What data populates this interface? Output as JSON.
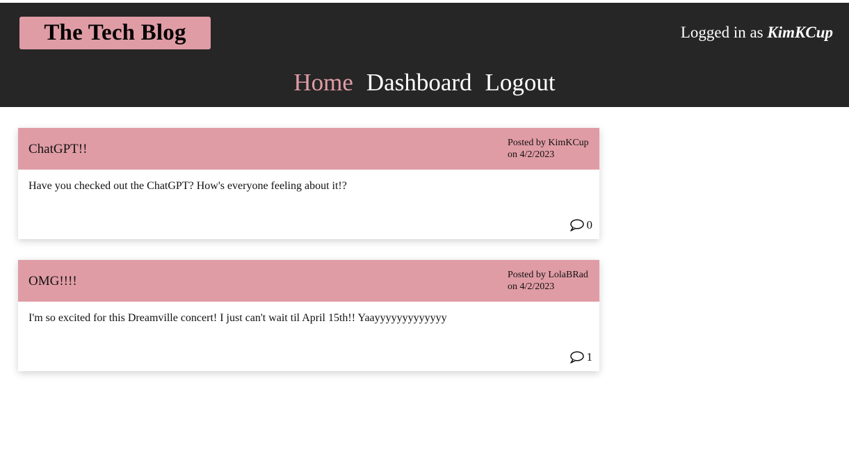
{
  "header": {
    "title": "The Tech Blog",
    "logged_in_prefix": "Logged in as ",
    "username": "KimKCup",
    "accent_color": "#e09ca5",
    "background_color": "#262626"
  },
  "nav": {
    "home": "Home",
    "dashboard": "Dashboard",
    "logout": "Logout",
    "active": "Home"
  },
  "posts": [
    {
      "title": "ChatGPT!!",
      "posted_by": "Posted by KimKCup",
      "date": "on 4/2/2023",
      "content": "Have you checked out the ChatGPT? How's everyone feeling about it!?",
      "comment_count": "0",
      "comment_icon": "speech-bubble-icon"
    },
    {
      "title": "OMG!!!!",
      "posted_by": "Posted by LolaBRad",
      "date": "on 4/2/2023",
      "content": "I'm so excited for this Dreamville concert! I just can't wait til April 15th!! Yaayyyyyyyyyyyyy",
      "comment_count": "1",
      "comment_icon": "speech-bubble-icon"
    }
  ]
}
